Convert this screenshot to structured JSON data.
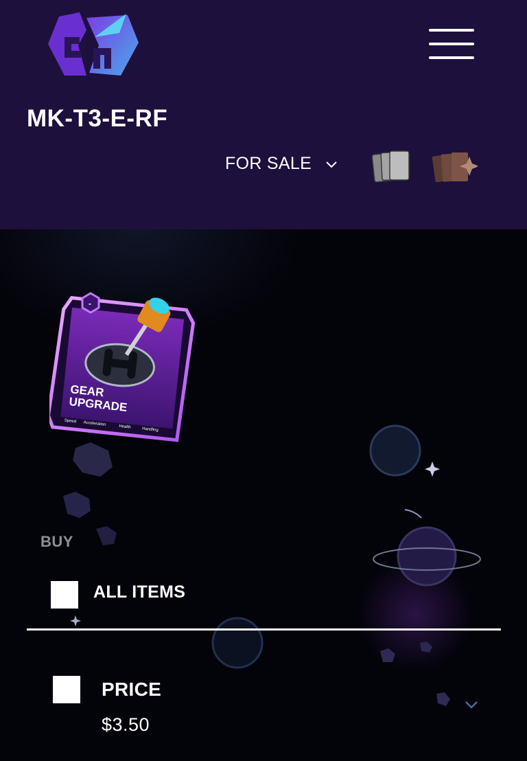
{
  "header": {
    "logo_icon": "rocket-logo-icon",
    "menu_icon": "hamburger-menu-icon",
    "title": "MK-T3-E-RF",
    "filter": {
      "selected": "FOR SALE",
      "icon": "chevron-down-icon"
    },
    "view_icons": [
      "cards-view-icon",
      "packs-view-icon"
    ]
  },
  "item": {
    "card_image": "gear-upgrade-card",
    "card_badge": "-",
    "card_name": "GEAR UPGRADE",
    "card_stats": [
      "Speed",
      "Acceleration",
      "Health",
      "Handling"
    ]
  },
  "buy": {
    "section_label": "BUY",
    "all_items_label": "ALL ITEMS",
    "price_label": "PRICE",
    "price_value": "$3.50",
    "expand_icon": "chevron-down-icon"
  },
  "colors": {
    "header_bg": "#1e103c",
    "page_bg": "#03030a",
    "accent_purple": "#8b3fd6",
    "muted_text": "#8e8e96"
  }
}
